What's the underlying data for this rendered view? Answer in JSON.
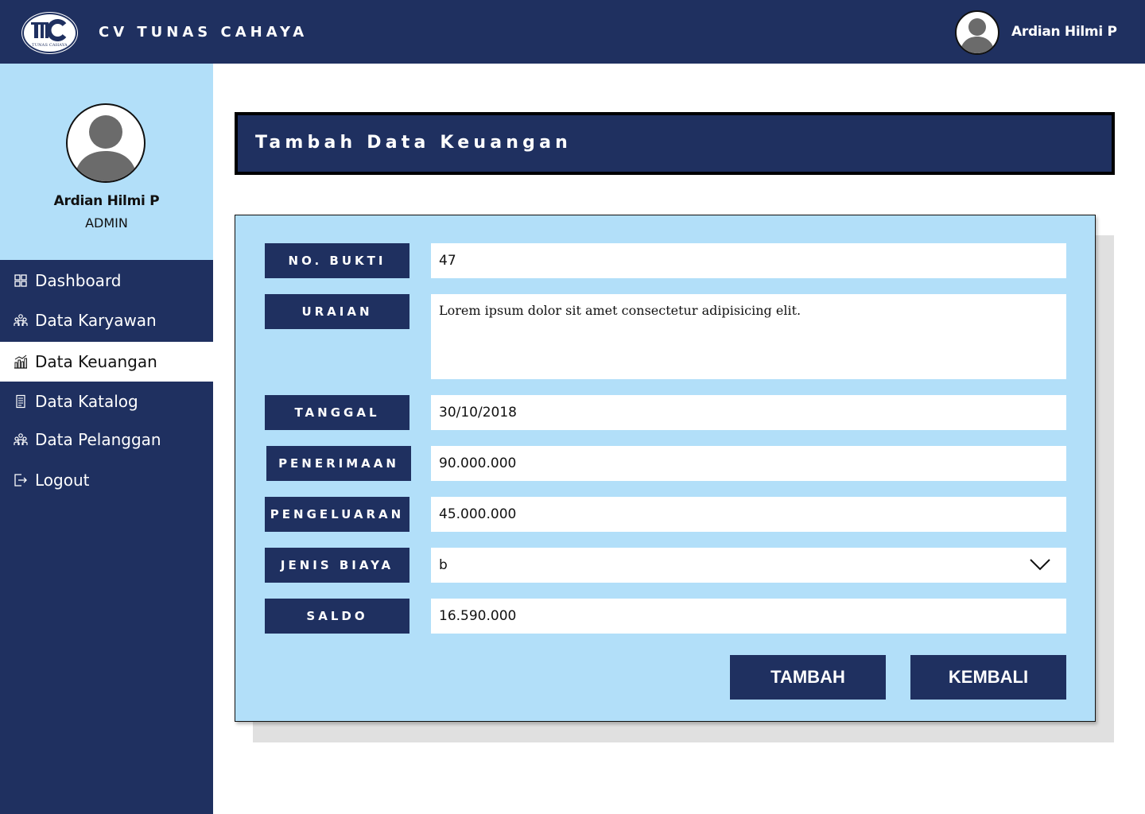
{
  "header": {
    "brand": "CV TUNAS CAHAYA",
    "logo_text": "TUNAS CAHAYA",
    "user_name": "Ardian Hilmi P"
  },
  "sidebar": {
    "profile": {
      "name": "Ardian Hilmi P",
      "role": "ADMIN"
    },
    "items": [
      {
        "label": "Dashboard",
        "icon": "dashboard-grid-icon"
      },
      {
        "label": "Data Karyawan",
        "icon": "people-icon"
      },
      {
        "label": "Data Keuangan",
        "icon": "finance-chart-icon",
        "active": true
      },
      {
        "label": "Data Katalog",
        "icon": "catalog-icon"
      },
      {
        "label": "Data Pelanggan",
        "icon": "people-icon"
      },
      {
        "label": "Logout",
        "icon": "logout-icon"
      }
    ]
  },
  "page": {
    "title": "Tambah Data Keuangan"
  },
  "form": {
    "no_bukti": {
      "label": "NO. BUKTI",
      "value": "47"
    },
    "uraian": {
      "label": "URAIAN",
      "value": "Lorem ipsum dolor sit amet consectetur adipisicing elit."
    },
    "tanggal": {
      "label": "TANGGAL",
      "value": "30/10/2018"
    },
    "penerimaan": {
      "label": "PENERIMAAN",
      "value": "90.000.000"
    },
    "pengeluaran": {
      "label": "PENGELUARAN",
      "value": "45.000.000"
    },
    "jenis_biaya": {
      "label": "JENIS BIAYA",
      "value": "b"
    },
    "saldo": {
      "label": "SALDO",
      "value": "16.590.000"
    }
  },
  "actions": {
    "add": "TAMBAH",
    "back": "KEMBALI"
  },
  "colors": {
    "primary": "#1f3060",
    "light": "#b2dff9",
    "shadow": "#e0e0e0"
  }
}
